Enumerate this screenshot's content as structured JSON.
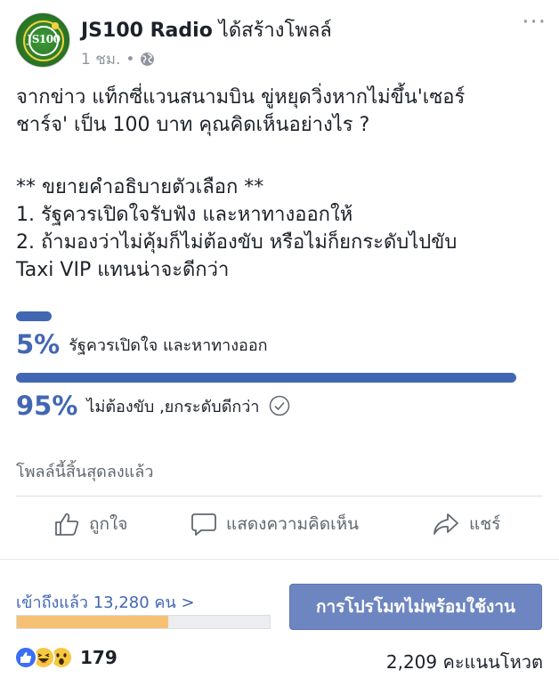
{
  "post": {
    "page_name": "JS100 Radio",
    "action_text": " ได้สร้างโพลล์",
    "time": "1 ชม.",
    "dot": "•",
    "more": "···",
    "avatar_text": "JS100",
    "body": {
      "line1": "จากข่าว แท็กซี่แวนสนามบิน ขู่หยุดวิ่งหากไม่ขึ้น'เซอร์",
      "line2": "ชาร์จ' เป็น 100 บาท คุณคิดเห็นอย่างไร ?",
      "line3": "** ขยายคำอธิบายตัวเลือก **",
      "line4": "1. รัฐควรเปิดใจรับฟัง และหาทางออกให้",
      "line5": "2. ถ้ามองว่าไม่คุ้มก็ไม่ต้องขับ หรือไม่ก็ยกระดับไปขับ",
      "line6": "Taxi VIP แทนน่าจะดีกว่า"
    }
  },
  "poll": {
    "options": [
      {
        "percent_label": "5%",
        "percent": 5,
        "label": "รัฐควรเปิดใจ และหาทางออก",
        "voted": false
      },
      {
        "percent_label": "95%",
        "percent": 95,
        "label": "ไม่ต้องขับ ,ยกระดับดีกว่า",
        "voted": true
      }
    ],
    "ended_text": "โพลล์นี้สิ้นสุดลงแล้ว",
    "bar_color": "#4267b2"
  },
  "actions": {
    "like": "ถูกใจ",
    "comment": "แสดงความคิดเห็น",
    "share": "แชร์"
  },
  "insights": {
    "reach_text": "เข้าถึงแล้ว 13,280 คน",
    "reach_chevron": ">",
    "reach_progress": 0.6,
    "promote_button": "การโปรโมทไม่พร้อมใช้งาน"
  },
  "footer": {
    "reaction_icons": [
      "like-icon",
      "haha-icon",
      "wow-icon"
    ],
    "reaction_count": "179",
    "votes": "2,209 คะแนนโหวต"
  }
}
